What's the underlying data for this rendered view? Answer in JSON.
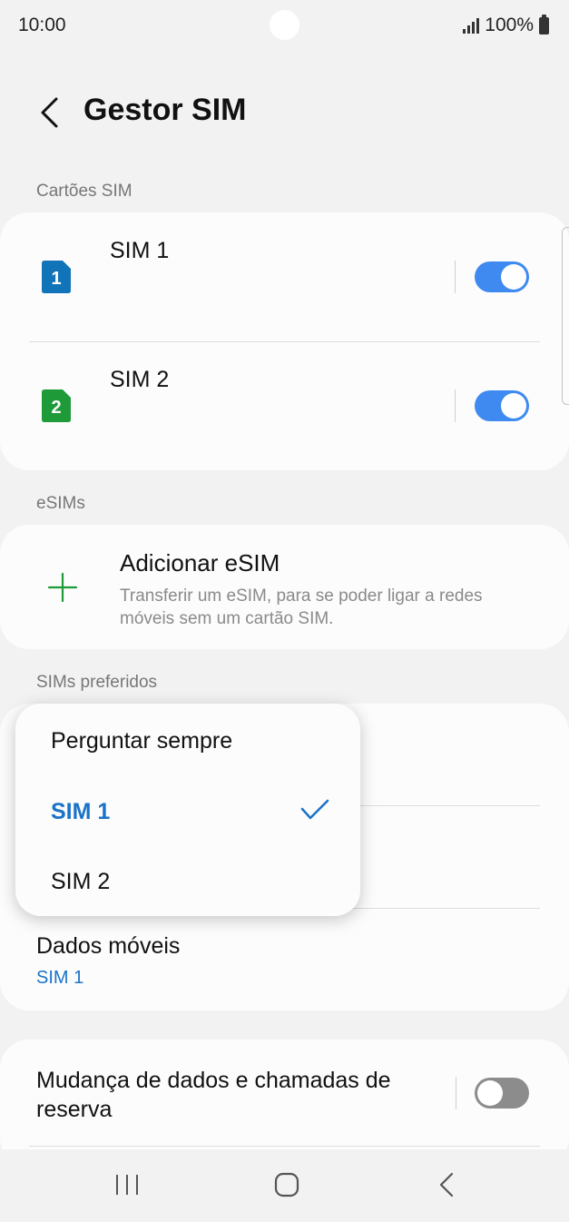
{
  "status_bar": {
    "time": "10:00",
    "battery": "100%"
  },
  "header": {
    "title": "Gestor SIM"
  },
  "sections": {
    "sim_cards": "Cartões SIM",
    "esims": "eSIMs",
    "preferred": "SIMs preferidos"
  },
  "sim_cards": [
    {
      "name": "SIM 1",
      "badge": "1",
      "color": "#1274b8",
      "enabled": true
    },
    {
      "name": "SIM 2",
      "badge": "2",
      "color": "#1e9a38",
      "enabled": true
    }
  ],
  "esim": {
    "title": "Adicionar eSIM",
    "description": "Transferir um eSIM, para se poder ligar a redes móveis sem um cartão SIM.",
    "icon": "plus-icon",
    "icon_color": "#1e9a38"
  },
  "preferred": {
    "mobile_data": {
      "label": "Dados móveis",
      "value": "SIM 1"
    }
  },
  "backup": {
    "label": "Mudança de dados e chamadas de reserva",
    "enabled": false
  },
  "dropdown": {
    "options": [
      "Perguntar sempre",
      "SIM 1",
      "SIM 2"
    ],
    "selected": "SIM 1"
  },
  "nav": [
    "recent-apps-icon",
    "home-icon",
    "back-icon"
  ],
  "colors": {
    "accent": "#3e8af0",
    "link": "#1a73c8",
    "background": "#f2f2f2",
    "card": "#fcfcfc"
  }
}
